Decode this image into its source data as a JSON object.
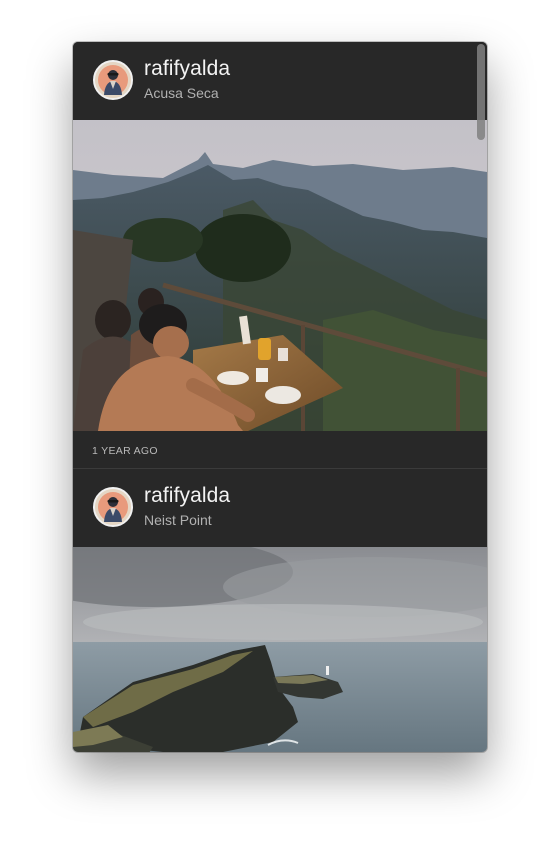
{
  "posts": [
    {
      "username": "rafifyalda",
      "location": "Acusa Seca",
      "timestamp": "1 YEAR AGO",
      "photo_subject": "people-dining-on-mountain-terrace"
    },
    {
      "username": "rafifyalda",
      "location": "Neist Point",
      "photo_subject": "sea-cliff-headland-under-cloudy-sky"
    }
  ],
  "colors": {
    "background": "#282828",
    "username": "#f3f3f3",
    "location": "#b1b1b1",
    "timestamp": "#b9b9b9"
  }
}
